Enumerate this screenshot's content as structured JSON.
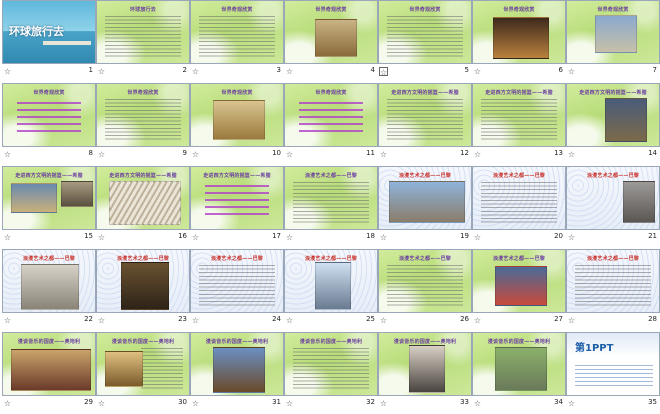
{
  "slides": [
    {
      "number": "1",
      "title": "环球旅行去",
      "theme": "title"
    },
    {
      "number": "2",
      "title": "环球旅行去",
      "theme": "green"
    },
    {
      "number": "3",
      "title": "世界奇观欣赏",
      "theme": "green"
    },
    {
      "number": "4",
      "title": "世界奇观欣赏",
      "theme": "green"
    },
    {
      "number": "5",
      "title": "世界奇观欣赏",
      "theme": "green"
    },
    {
      "number": "6",
      "title": "世界奇观欣赏",
      "theme": "green"
    },
    {
      "number": "7",
      "title": "世界奇观欣赏",
      "theme": "green"
    },
    {
      "number": "8",
      "title": "世界奇观欣赏",
      "theme": "green"
    },
    {
      "number": "9",
      "title": "世界奇观欣赏",
      "theme": "green"
    },
    {
      "number": "10",
      "title": "世界奇观欣赏",
      "theme": "green"
    },
    {
      "number": "11",
      "title": "世界奇观欣赏",
      "theme": "green"
    },
    {
      "number": "12",
      "title": "走进西方文明的摇篮——希腊",
      "theme": "green"
    },
    {
      "number": "13",
      "title": "走进西方文明的摇篮——希腊",
      "theme": "green"
    },
    {
      "number": "14",
      "title": "走进西方文明的摇篮——希腊",
      "theme": "green"
    },
    {
      "number": "15",
      "title": "走进西方文明的摇篮——希腊",
      "theme": "green"
    },
    {
      "number": "16",
      "title": "走进西方文明的摇篮——希腊",
      "theme": "green"
    },
    {
      "number": "17",
      "title": "走进西方文明的摇篮——希腊",
      "theme": "green"
    },
    {
      "number": "18",
      "title": "浪漫艺术之都——巴黎",
      "theme": "green"
    },
    {
      "number": "19",
      "title": "浪漫艺术之都——巴黎",
      "theme": "dots"
    },
    {
      "number": "20",
      "title": "浪漫艺术之都——巴黎",
      "theme": "dots"
    },
    {
      "number": "21",
      "title": "浪漫艺术之都——巴黎",
      "theme": "dots"
    },
    {
      "number": "22",
      "title": "浪漫艺术之都——巴黎",
      "theme": "dots"
    },
    {
      "number": "23",
      "title": "浪漫艺术之都——巴黎",
      "theme": "dots"
    },
    {
      "number": "24",
      "title": "浪漫艺术之都——巴黎",
      "theme": "dots"
    },
    {
      "number": "25",
      "title": "浪漫艺术之都——巴黎",
      "theme": "dots"
    },
    {
      "number": "26",
      "title": "浪漫艺术之都——巴黎",
      "theme": "green"
    },
    {
      "number": "27",
      "title": "浪漫艺术之都——巴黎",
      "theme": "green"
    },
    {
      "number": "28",
      "title": "浪漫艺术之都——巴黎",
      "theme": "dots"
    },
    {
      "number": "29",
      "title": "漫谈音乐的国度——奥地利",
      "theme": "green"
    },
    {
      "number": "30",
      "title": "漫谈音乐的国度——奥地利",
      "theme": "green"
    },
    {
      "number": "31",
      "title": "漫谈音乐的国度——奥地利",
      "theme": "green"
    },
    {
      "number": "32",
      "title": "漫谈音乐的国度——奥地利",
      "theme": "green"
    },
    {
      "number": "33",
      "title": "漫谈音乐的国度——奥地利",
      "theme": "green"
    },
    {
      "number": "34",
      "title": "漫谈音乐的国度——奥地利",
      "theme": "green"
    },
    {
      "number": "35",
      "title": "第1PPT",
      "theme": "ppt"
    }
  ],
  "selected_slide": "5",
  "transition_icon": "slide-transition-icon"
}
